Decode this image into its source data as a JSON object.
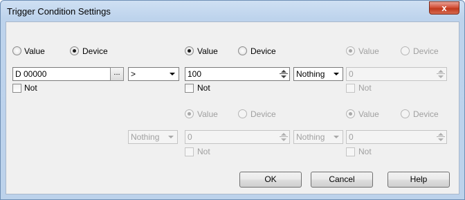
{
  "window": {
    "title": "Trigger Condition Settings",
    "close_label": "x"
  },
  "row1": {
    "left": {
      "radio_value_label": "Value",
      "radio_device_label": "Device",
      "selected": "Device",
      "device_field": "D 00000",
      "browse_label": "...",
      "not_label": "Not"
    },
    "operator": {
      "value": ">"
    },
    "mid": {
      "radio_value_label": "Value",
      "radio_device_label": "Device",
      "selected": "Value",
      "value_field": "100",
      "not_label": "Not"
    },
    "connector": {
      "value": "Nothing"
    },
    "right": {
      "radio_value_label": "Value",
      "radio_device_label": "Device",
      "selected": "Value",
      "value_field": "0",
      "not_label": "Not",
      "enabled": false
    }
  },
  "row2": {
    "connector_left": {
      "value": "Nothing"
    },
    "mid": {
      "radio_value_label": "Value",
      "radio_device_label": "Device",
      "selected": "Value",
      "value_field": "0",
      "not_label": "Not",
      "enabled": false
    },
    "connector_right": {
      "value": "Nothing"
    },
    "right": {
      "radio_value_label": "Value",
      "radio_device_label": "Device",
      "selected": "Value",
      "value_field": "0",
      "not_label": "Not",
      "enabled": false
    }
  },
  "buttons": {
    "ok": "OK",
    "cancel": "Cancel",
    "help": "Help"
  }
}
